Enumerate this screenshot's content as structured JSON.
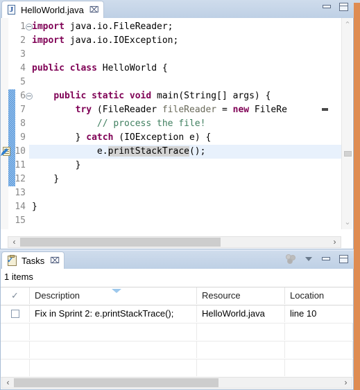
{
  "editor": {
    "tab": {
      "label": "HelloWorld.java",
      "icon": "java-file-icon",
      "letter": "J",
      "close": "⌧"
    },
    "window_controls": {
      "minimize": "minimize-icon",
      "maximize": "maximize-icon"
    },
    "lines": [
      {
        "no": "1",
        "fold": true,
        "marker": false,
        "highlight": false,
        "segments": [
          {
            "t": "import",
            "c": "kw"
          },
          {
            "t": " java.io.FileReader;",
            "c": ""
          }
        ]
      },
      {
        "no": "2",
        "fold": false,
        "marker": false,
        "highlight": false,
        "segments": [
          {
            "t": "import",
            "c": "kw"
          },
          {
            "t": " java.io.IOException;",
            "c": ""
          }
        ]
      },
      {
        "no": "3",
        "fold": false,
        "marker": false,
        "highlight": false,
        "segments": []
      },
      {
        "no": "4",
        "fold": false,
        "marker": false,
        "highlight": false,
        "segments": [
          {
            "t": "public class",
            "c": "kw"
          },
          {
            "t": " HelloWorld {",
            "c": ""
          }
        ]
      },
      {
        "no": "5",
        "fold": false,
        "marker": false,
        "highlight": false,
        "segments": []
      },
      {
        "no": "6",
        "fold": true,
        "marker": false,
        "highlight": false,
        "segments": [
          {
            "t": "    ",
            "c": ""
          },
          {
            "t": "public static void",
            "c": "kw"
          },
          {
            "t": " main(String[] args) {",
            "c": ""
          }
        ]
      },
      {
        "no": "7",
        "fold": false,
        "marker": false,
        "highlight": false,
        "segments": [
          {
            "t": "        ",
            "c": ""
          },
          {
            "t": "try",
            "c": "kw"
          },
          {
            "t": " (FileReader ",
            "c": ""
          },
          {
            "t": "fileReader",
            "c": "lvar"
          },
          {
            "t": " = ",
            "c": ""
          },
          {
            "t": "new",
            "c": "kw"
          },
          {
            "t": " FileRe",
            "c": ""
          }
        ]
      },
      {
        "no": "8",
        "fold": false,
        "marker": false,
        "highlight": false,
        "segments": [
          {
            "t": "            ",
            "c": ""
          },
          {
            "t": "// process the file!",
            "c": "cmt"
          }
        ]
      },
      {
        "no": "9",
        "fold": false,
        "marker": false,
        "highlight": false,
        "segments": [
          {
            "t": "        } ",
            "c": ""
          },
          {
            "t": "catch",
            "c": "kw"
          },
          {
            "t": " (IOException e) {",
            "c": ""
          }
        ]
      },
      {
        "no": "10",
        "fold": false,
        "marker": true,
        "highlight": true,
        "segments": [
          {
            "t": "            e.",
            "c": ""
          },
          {
            "t": "printStackTrace",
            "c": "occ"
          },
          {
            "t": "();",
            "c": ""
          }
        ]
      },
      {
        "no": "11",
        "fold": false,
        "marker": false,
        "highlight": false,
        "segments": [
          {
            "t": "        }",
            "c": ""
          }
        ]
      },
      {
        "no": "12",
        "fold": false,
        "marker": false,
        "highlight": false,
        "segments": [
          {
            "t": "    }",
            "c": ""
          }
        ]
      },
      {
        "no": "13",
        "fold": false,
        "marker": false,
        "highlight": false,
        "segments": []
      },
      {
        "no": "14",
        "fold": false,
        "marker": false,
        "highlight": false,
        "segments": [
          {
            "t": "}",
            "c": ""
          }
        ]
      },
      {
        "no": "15",
        "fold": false,
        "marker": false,
        "highlight": false,
        "segments": []
      }
    ],
    "scroll": {
      "up_arrow": "⌃",
      "down_arrow": "⌄",
      "left_arrow": "‹",
      "right_arrow": "›"
    },
    "colors": {
      "keyword": "#7f0055",
      "comment": "#3f7f5f",
      "local_variable": "#6a6a5a",
      "occurrence_highlight": "#d4d4d4",
      "current_line_highlight": "#e8f1fc",
      "change_bar": "#4a90d9"
    }
  },
  "tasks": {
    "tab": {
      "label": "Tasks",
      "icon": "tasks-icon",
      "close": "⌧"
    },
    "toolbar": {
      "filters": "filters-icon",
      "view_menu": "view-menu-icon",
      "minimize": "minimize-icon",
      "maximize": "maximize-icon"
    },
    "items_count": "1 items",
    "columns": {
      "check": "✓",
      "description": "Description",
      "resource": "Resource",
      "location": "Location"
    },
    "sorted_by": "description",
    "rows": [
      {
        "checked": false,
        "description": "Fix in Sprint 2: e.printStackTrace();",
        "resource": "HelloWorld.java",
        "location": "line 10"
      }
    ],
    "scroll": {
      "left_arrow": "‹",
      "right_arrow": "›"
    }
  }
}
